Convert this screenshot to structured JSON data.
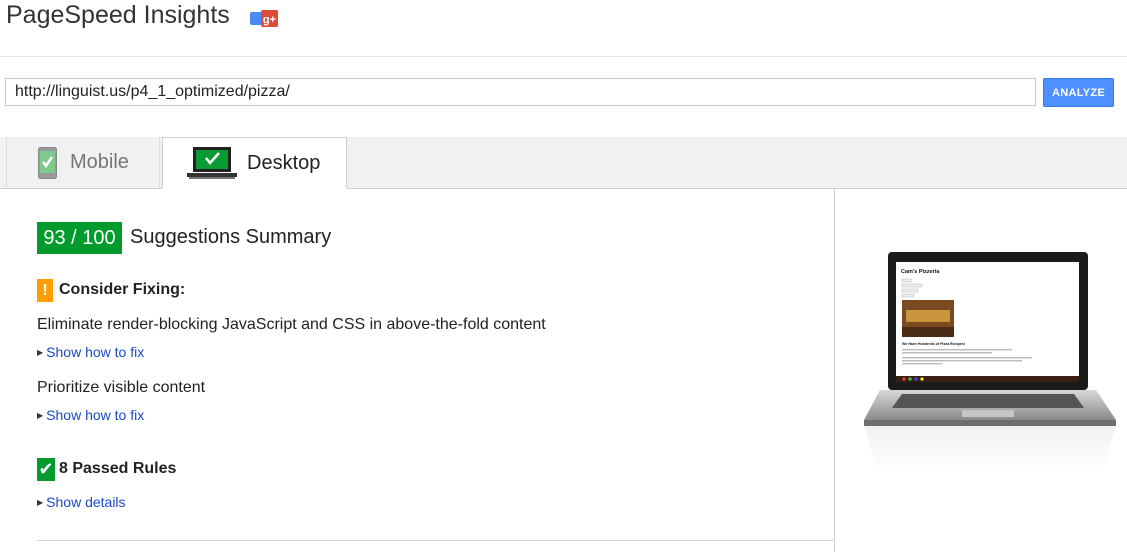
{
  "header": {
    "title": "PageSpeed Insights",
    "gplus_label": "g+"
  },
  "search": {
    "url_value": "http://linguist.us/p4_1_optimized/pizza/",
    "analyze_label": "ANALYZE"
  },
  "tabs": [
    {
      "label": "Mobile",
      "active": false
    },
    {
      "label": "Desktop",
      "active": true
    }
  ],
  "summary": {
    "score": "93 / 100",
    "title": "Suggestions Summary"
  },
  "consider_fixing": {
    "icon_text": "!",
    "heading": "Consider Fixing:",
    "rules": [
      {
        "text": "Eliminate render-blocking JavaScript and CSS in above-the-fold content",
        "link": "Show how to fix"
      },
      {
        "text": "Prioritize visible content",
        "link": "Show how to fix"
      }
    ]
  },
  "passed": {
    "icon_text": "✔",
    "heading": "8 Passed Rules",
    "link": "Show details"
  },
  "preview": {
    "site_title": "Cam's Pizzeria",
    "headline": "We Have Hundreds of Pizza Recipes!"
  },
  "colors": {
    "score_green": "#009a2d",
    "warn_orange": "#ff9e00",
    "link_blue": "#1a48c7",
    "analyze_blue": "#4d90fe"
  }
}
